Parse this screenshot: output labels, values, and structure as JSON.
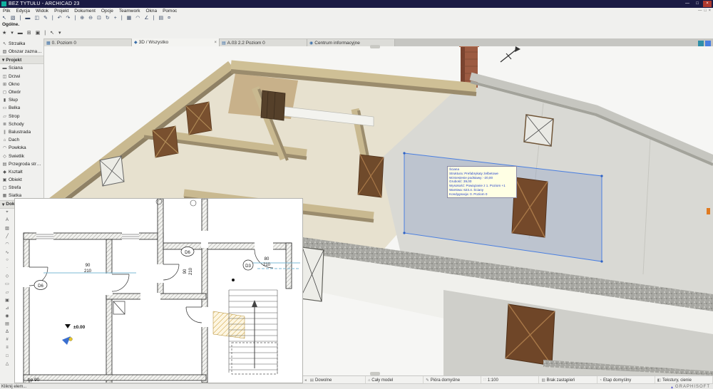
{
  "window": {
    "title": "BEZ TYTUŁU - ARCHICAD 23"
  },
  "ui": {
    "min": "—",
    "max": "□",
    "close": "×",
    "dropdown": "▾",
    "section_arrow": "▾",
    "chevron": "◂"
  },
  "menu": {
    "items": [
      "Plik",
      "Edycja",
      "Widok",
      "Projekt",
      "Dokument",
      "Opcje",
      "Teamwork",
      "Okna",
      "Pomoc"
    ]
  },
  "toolbar": {
    "icons": [
      {
        "name": "arrow-tool-icon",
        "glyph": "↖"
      },
      {
        "name": "marquee-tool-icon",
        "glyph": "▧"
      },
      {
        "name": "separator",
        "glyph": "|"
      },
      {
        "name": "wall-tool-icon",
        "glyph": "▬"
      },
      {
        "name": "door-tool-icon",
        "glyph": "◫"
      },
      {
        "name": "pen-icon",
        "glyph": "✎"
      },
      {
        "name": "separator",
        "glyph": "|"
      },
      {
        "name": "undo-icon",
        "glyph": "↶"
      },
      {
        "name": "redo-icon",
        "glyph": "↷"
      },
      {
        "name": "separator",
        "glyph": "|"
      },
      {
        "name": "zoom-in-icon",
        "glyph": "⊕"
      },
      {
        "name": "zoom-out-icon",
        "glyph": "⊖"
      },
      {
        "name": "fit-view-icon",
        "glyph": "⊡"
      },
      {
        "name": "orbit-icon",
        "glyph": "↻"
      },
      {
        "name": "pan-icon",
        "glyph": "+"
      },
      {
        "name": "separator",
        "glyph": "|"
      },
      {
        "name": "grid-icon",
        "glyph": "▦"
      },
      {
        "name": "magnet-icon",
        "glyph": "◠"
      },
      {
        "name": "guides-icon",
        "glyph": "∠"
      },
      {
        "name": "separator",
        "glyph": "|"
      },
      {
        "name": "layers-icon",
        "glyph": "▤"
      },
      {
        "name": "settings-icon",
        "glyph": "¤"
      }
    ]
  },
  "infobox": {
    "label": "Ogólne.",
    "controls": [
      {
        "name": "favorite-icon",
        "glyph": "★"
      },
      {
        "name": "dropdown-icon",
        "glyph": "▾"
      },
      {
        "name": "wall-icon",
        "glyph": "▬"
      },
      {
        "name": "window-icon",
        "glyph": "⊞"
      },
      {
        "name": "object-icon",
        "glyph": "▣"
      },
      {
        "name": "separator",
        "glyph": "|"
      },
      {
        "name": "arrow-icon",
        "glyph": "↖"
      },
      {
        "name": "dropdown-icon",
        "glyph": "▾"
      }
    ]
  },
  "tabs": [
    {
      "icon": "▦",
      "label": "0. Poziom 0"
    },
    {
      "icon": "◆",
      "label": "3D / Wszystko"
    },
    {
      "icon": "▤",
      "label": "A.03 2.2 Poziom 0"
    },
    {
      "icon": "◉",
      "label": "Centrum informacyjne"
    }
  ],
  "toolbox": {
    "select_tools": [
      {
        "icon": "↖",
        "label": "Strzałka"
      },
      {
        "icon": "▧",
        "label": "Obszar zaznaczenia"
      }
    ],
    "project_header": "Projekt",
    "project_tools": [
      {
        "icon": "▬",
        "label": "Ściana"
      },
      {
        "icon": "◫",
        "label": "Drzwi"
      },
      {
        "icon": "⊞",
        "label": "Okno"
      },
      {
        "icon": "◻",
        "label": "Otwór"
      },
      {
        "icon": "▮",
        "label": "Słup"
      },
      {
        "icon": "▭",
        "label": "Belka"
      },
      {
        "icon": "▱",
        "label": "Strop"
      },
      {
        "icon": "≣",
        "label": "Schody"
      },
      {
        "icon": "∥",
        "label": "Balustrada"
      },
      {
        "icon": "⌂",
        "label": "Dach"
      },
      {
        "icon": "◠",
        "label": "Powłoka"
      },
      {
        "icon": "◇",
        "label": "Świetlik"
      },
      {
        "icon": "▤",
        "label": "Przegroda strukturalna"
      },
      {
        "icon": "◆",
        "label": "Kształt"
      },
      {
        "icon": "▣",
        "label": "Obiekt"
      },
      {
        "icon": "▢",
        "label": "Strefa"
      },
      {
        "icon": "▦",
        "label": "Siatka"
      }
    ],
    "document_header": "Dokument",
    "document_tools": [
      {
        "name": "dimension-tool-icon",
        "glyph": "⌖"
      },
      {
        "name": "text-tool-icon",
        "glyph": "A"
      },
      {
        "name": "fill-tool-icon",
        "glyph": "▨"
      },
      {
        "name": "line-tool-icon",
        "glyph": "╱"
      },
      {
        "name": "arc-tool-icon",
        "glyph": "◠"
      },
      {
        "name": "spline-tool-icon",
        "glyph": "∿"
      },
      {
        "name": "circle-tool-icon",
        "glyph": "○"
      },
      {
        "name": "hotspot-tool-icon",
        "glyph": "·"
      },
      {
        "name": "label-tool-icon",
        "glyph": "◇"
      },
      {
        "name": "figure-tool-icon",
        "glyph": "▭"
      },
      {
        "name": "drawing-tool-icon",
        "glyph": "▱"
      },
      {
        "name": "camera-tool-icon",
        "glyph": "▣"
      },
      {
        "name": "section-tool-icon",
        "glyph": "⊿"
      },
      {
        "name": "detail-tool-icon",
        "glyph": "◉"
      },
      {
        "name": "worksheet-tool-icon",
        "glyph": "▤"
      },
      {
        "name": "delta-icon",
        "glyph": "Δ"
      },
      {
        "name": "revision-icon",
        "glyph": "#"
      },
      {
        "name": "stairs-doc-icon",
        "glyph": "≡"
      },
      {
        "name": "box-icon",
        "glyph": "□"
      },
      {
        "name": "marker-icon",
        "glyph": "△"
      }
    ]
  },
  "tooltip": {
    "lines": [
      "Ściana",
      "Struktura: Prefabrykaty żelbetowe",
      "Wzniesienie podstawy: -20,00",
      "Grubość: 39,00",
      "Wysokość: Powiązanie z 1. Poziom +1",
      "Warstwa: 623.4. Ściany",
      "Kondygnacja: 0. Poziom 0"
    ]
  },
  "plan": {
    "door1": "D6",
    "door2": "D6",
    "door3": "D3",
    "dimA_w": "90",
    "dimA_h": "210",
    "dimB_w": "90",
    "dimB_h": "210",
    "dimC_w": "80",
    "dimC_h": "210",
    "level": "±0.00",
    "hp": "hp 90"
  },
  "quickbar": {
    "segments": [
      {
        "icon": "▤",
        "label": "Dowolne"
      },
      {
        "icon": "⌂",
        "label": "Cały model"
      },
      {
        "icon": "✎",
        "label": "Pióra domyślne"
      },
      {
        "icon": "∷",
        "label": "1:100"
      },
      {
        "icon": "▨",
        "label": "Brak zastąpień"
      },
      {
        "icon": "◔",
        "label": "Etap domyślny"
      },
      {
        "icon": "◧",
        "label": "Tekstury, cienie"
      }
    ]
  },
  "statusbar": {
    "hint": "Kliknij elem...",
    "brand": "GRAPHISOFT",
    "logo": "▴"
  },
  "colors": {
    "titlebar": "#1b1b44",
    "selection_blue": "#4a7fe0",
    "wall_tan": "#c9b990",
    "concrete_gray": "#a7a7a2",
    "brick": "#9c5b42",
    "tooltip_text": "#2643c8",
    "accent_teal": "#0faf9f"
  }
}
